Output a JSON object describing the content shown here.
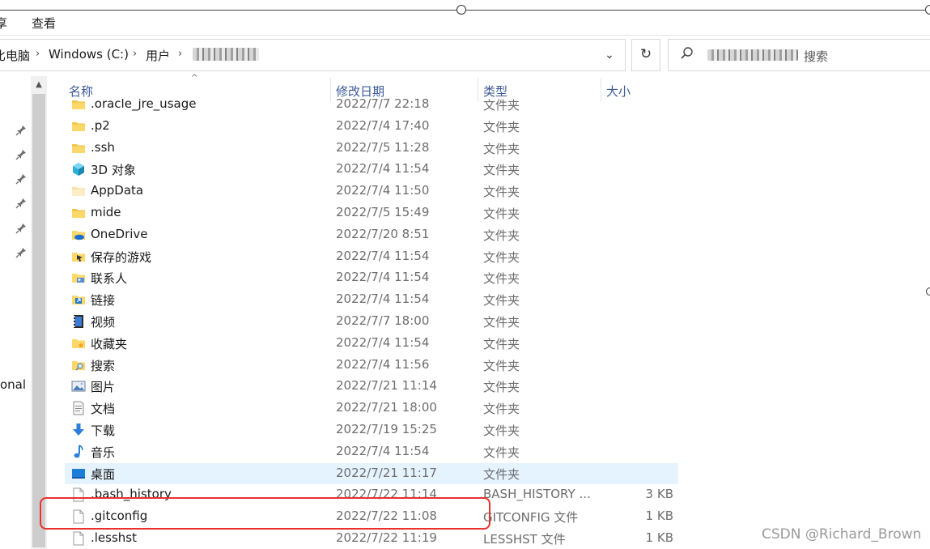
{
  "ribbon": {
    "tab_partial": "享",
    "tab_view": "查看"
  },
  "address": {
    "crumbs": [
      "此电脑",
      "Windows (C:)",
      "用户"
    ],
    "crumb_visible_0": "比电脑"
  },
  "search": {
    "placeholder_suffix": "搜索"
  },
  "nav": {
    "partial_text": "onal"
  },
  "columns": {
    "name": "名称",
    "date": "修改日期",
    "type": "类型",
    "size": "大小"
  },
  "rows": [
    {
      "icon": "folder-icon",
      "name": ".oracle_jre_usage",
      "date": "2022/7/7 22:18",
      "type": "文件夹",
      "size": ""
    },
    {
      "icon": "folder-icon",
      "name": ".p2",
      "date": "2022/7/4 17:40",
      "type": "文件夹",
      "size": ""
    },
    {
      "icon": "folder-icon",
      "name": ".ssh",
      "date": "2022/7/5 11:28",
      "type": "文件夹",
      "size": ""
    },
    {
      "icon": "3d-objects-icon",
      "name": "3D 对象",
      "date": "2022/7/4 11:54",
      "type": "文件夹",
      "size": ""
    },
    {
      "icon": "folder-light-icon",
      "name": "AppData",
      "date": "2022/7/4 11:50",
      "type": "文件夹",
      "size": ""
    },
    {
      "icon": "folder-icon",
      "name": "mide",
      "date": "2022/7/5 15:49",
      "type": "文件夹",
      "size": ""
    },
    {
      "icon": "onedrive-icon",
      "name": "OneDrive",
      "date": "2022/7/20 8:51",
      "type": "文件夹",
      "size": ""
    },
    {
      "icon": "saved-games-icon",
      "name": "保存的游戏",
      "date": "2022/7/4 11:54",
      "type": "文件夹",
      "size": ""
    },
    {
      "icon": "contacts-icon",
      "name": "联系人",
      "date": "2022/7/4 11:54",
      "type": "文件夹",
      "size": ""
    },
    {
      "icon": "links-icon",
      "name": "链接",
      "date": "2022/7/4 11:54",
      "type": "文件夹",
      "size": ""
    },
    {
      "icon": "videos-icon",
      "name": "视频",
      "date": "2022/7/7 18:00",
      "type": "文件夹",
      "size": ""
    },
    {
      "icon": "favorites-icon",
      "name": "收藏夹",
      "date": "2022/7/4 11:54",
      "type": "文件夹",
      "size": ""
    },
    {
      "icon": "searches-icon",
      "name": "搜索",
      "date": "2022/7/4 11:56",
      "type": "文件夹",
      "size": ""
    },
    {
      "icon": "pictures-icon",
      "name": "图片",
      "date": "2022/7/21 11:14",
      "type": "文件夹",
      "size": ""
    },
    {
      "icon": "documents-icon",
      "name": "文档",
      "date": "2022/7/21 18:00",
      "type": "文件夹",
      "size": ""
    },
    {
      "icon": "downloads-icon",
      "name": "下载",
      "date": "2022/7/19 15:25",
      "type": "文件夹",
      "size": ""
    },
    {
      "icon": "music-icon",
      "name": "音乐",
      "date": "2022/7/4 11:54",
      "type": "文件夹",
      "size": ""
    },
    {
      "icon": "desktop-icon",
      "name": "桌面",
      "date": "2022/7/21 11:17",
      "type": "文件夹",
      "size": "",
      "state": "hover"
    },
    {
      "icon": "file-icon",
      "name": ".bash_history",
      "date": "2022/7/22 11:14",
      "type": "BASH_HISTORY ...",
      "size": "3 KB"
    },
    {
      "icon": "file-icon",
      "name": ".gitconfig",
      "date": "2022/7/22 11:08",
      "type": "GITCONFIG 文件",
      "size": "1 KB",
      "state": "outlined"
    },
    {
      "icon": "file-icon",
      "name": ".lesshst",
      "date": "2022/7/22 11:19",
      "type": "LESSHST 文件",
      "size": "1 KB"
    }
  ],
  "colors": {
    "accent": "#cce8ff",
    "hover": "#e5f3ff",
    "annotation": "#e8322d"
  },
  "watermark": "CSDN @Richard_Brown"
}
